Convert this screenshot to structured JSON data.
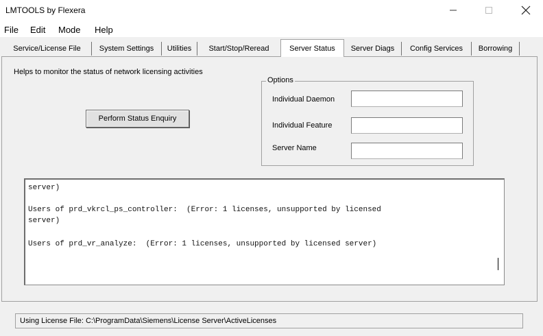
{
  "window": {
    "title": "LMTOOLS by Flexera"
  },
  "menu": [
    "File",
    "Edit",
    "Mode",
    "Help"
  ],
  "tabs": [
    "Service/License File",
    "System Settings",
    "Utilities",
    "Start/Stop/Reread",
    "Server Status",
    "Server Diags",
    "Config Services",
    "Borrowing"
  ],
  "active_tab": "Server Status",
  "panel": {
    "help_text": "Helps to monitor the status of network licensing activities",
    "status_button": "Perform Status Enquiry",
    "options": {
      "legend": "Options",
      "daemon_label": "Individual Daemon",
      "daemon_value": "",
      "feature_label": "Individual Feature",
      "feature_value": "",
      "server_label": "Server Name",
      "server_value": ""
    },
    "output_lines": [
      "server)",
      "",
      "Users of prd_vkrcl_ps_controller:  (Error: 1 licenses, unsupported by licensed",
      "server)",
      "",
      "Users of prd_vr_analyze:  (Error: 1 licenses, unsupported by licensed server)"
    ]
  },
  "status_bar": "Using License File:  C:\\ProgramData\\Siemens\\License Server\\ActiveLicenses"
}
